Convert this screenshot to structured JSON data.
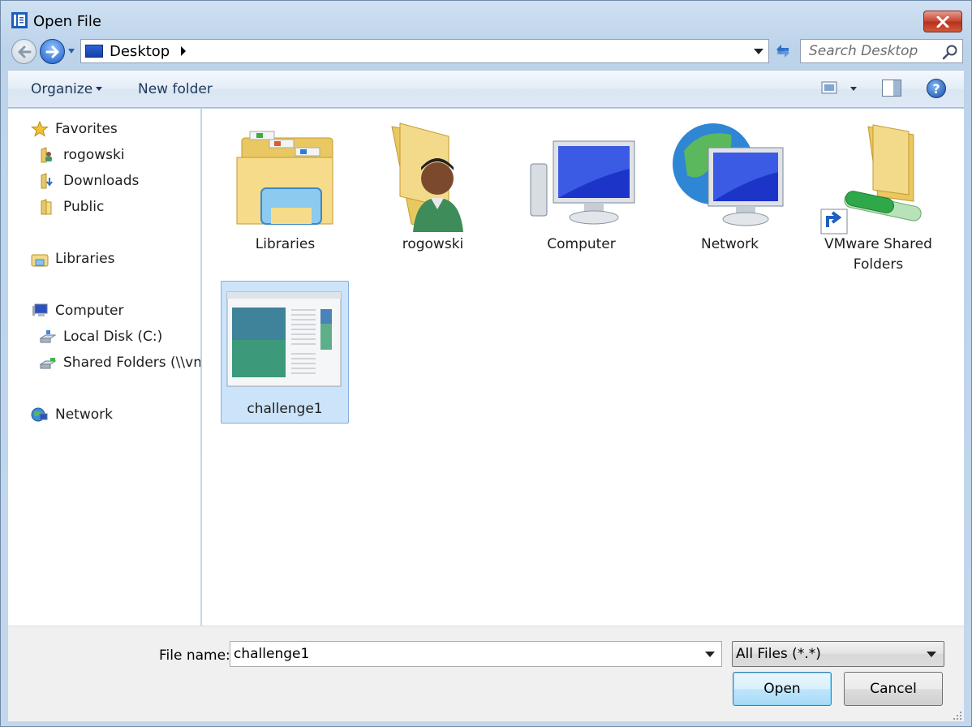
{
  "window": {
    "title": "Open File",
    "title_icon": "open-file-app-icon",
    "close_icon": "close-icon"
  },
  "address": {
    "location": "Desktop",
    "location_icon": "desktop-icon",
    "search_placeholder": "Search Desktop"
  },
  "toolbar": {
    "organize_label": "Organize",
    "new_folder_label": "New folder",
    "help_label": "?"
  },
  "nav": {
    "favorites": {
      "label": "Favorites",
      "items": [
        {
          "label": "rogowski"
        },
        {
          "label": "Downloads"
        },
        {
          "label": "Public"
        }
      ]
    },
    "libraries": {
      "label": "Libraries"
    },
    "computer": {
      "label": "Computer",
      "items": [
        {
          "label": "Local Disk (C:)"
        },
        {
          "label": "Shared Folders (\\\\vm"
        }
      ]
    },
    "network": {
      "label": "Network"
    }
  },
  "items": [
    {
      "label": "Libraries",
      "icon": "libraries-folder-icon"
    },
    {
      "label": "rogowski",
      "icon": "user-folder-icon"
    },
    {
      "label": "Computer",
      "icon": "computer-icon"
    },
    {
      "label": "Network",
      "icon": "network-globe-icon"
    },
    {
      "label_line1": "VMware Shared",
      "label_line2": "Folders",
      "icon": "shared-folder-shortcut-icon"
    },
    {
      "label": "challenge1",
      "icon": "document-thumbnail-icon",
      "selected": true
    }
  ],
  "bottom": {
    "file_name_label": "File name:",
    "file_name_value": "challenge1",
    "file_type_value": "All Files (*.*)",
    "open_label": "Open",
    "cancel_label": "Cancel"
  },
  "colors": {
    "selection_fill": "#cce4fa",
    "selection_border": "#84acdd",
    "close_red": "#c64330"
  }
}
